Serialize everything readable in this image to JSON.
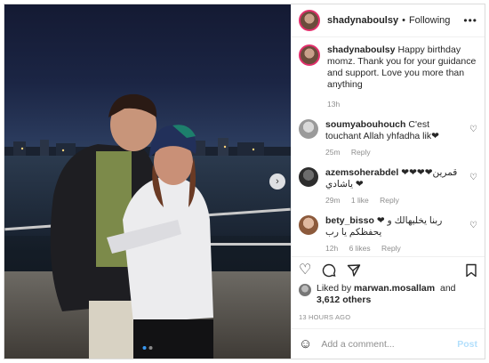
{
  "author": {
    "username": "shadynaboulsy",
    "separator": "•",
    "follow_label": "Following"
  },
  "header": {
    "more_icon": "more-horizontal-icon"
  },
  "caption": {
    "username": "shadynaboulsy",
    "text": "Happy birthday momz. Thank you for your guidance and support. Love you more than anything",
    "time": "13h"
  },
  "comments": [
    {
      "username": "soumyabouhouch",
      "text": "C'est touchant Allah yhfadha lik❤",
      "time": "25m",
      "reply": "Reply"
    },
    {
      "username": "azemsoherabdel",
      "text": "❤❤❤❤قمرين ياشادي ❤",
      "time": "29m",
      "likes": "1 like",
      "reply": "Reply"
    },
    {
      "username": "bety_bisso",
      "text": "❤ ربنا يخليهالك و يحفظكم يا رب",
      "time": "12h",
      "likes": "6 likes",
      "reply": "Reply"
    }
  ],
  "likes": {
    "prefix": "Liked by",
    "user": "marwan.mosallam",
    "middle": "and",
    "others": "3,612 others"
  },
  "timestamp": "13 HOURS AGO",
  "composer": {
    "placeholder": "Add a comment...",
    "post_label": "Post"
  },
  "carousel": {
    "next_icon": "chevron-right-icon",
    "page": 1,
    "total": 2
  }
}
